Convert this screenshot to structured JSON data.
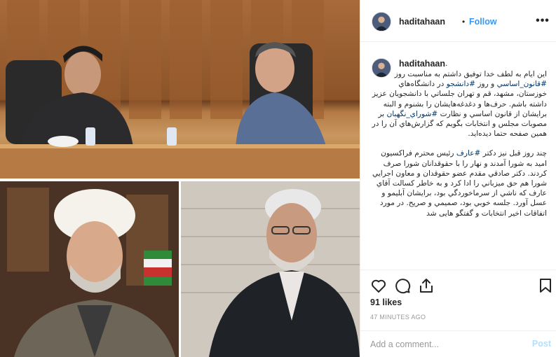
{
  "post": {
    "username": "haditahaan",
    "follow_label": "Follow",
    "more_label": "•••",
    "caption_username": "haditahaan",
    "caption_dot": ".",
    "caption_p1_a": "این ایام به لطف خدا توفیق داشتم به مناسبت روز",
    "caption_p1_tag1": "#قانون_اساسي",
    "caption_p1_b": "و روز",
    "caption_p1_tag2": "#دانشجو",
    "caption_p1_c": "در دانشگاه‌هاي خوزستان، مشهد، قم و تهران جلساتي با دانشجويان عزيز داشته باشم. حرف‌ها و دغدغه‌هايشان را بشنوم و البته برايشان از قانون اساسي و نظارت",
    "caption_p1_tag3": "#شوراي_نگهبان",
    "caption_p1_d": "بر مصوبات مجلس و انتخابات بگويم که گزارش‌هاي آن را در همين صفحه حتما ديده‌ايد.",
    "caption_p2_a": "چند روز قبل نيز دکتر",
    "caption_p2_tag1": "#عارف",
    "caption_p2_b": "رئيس محترم فراکسيون اميد به شورا آمدند و نهار را با حقوقدانان شورا صرف کردند. دکتر صادقي مقدم عضو حقوقدان و معاون اجرايي شورا هم حق ميزباني را ادا کرد و به خاطر کسالت آقاي عارف که ناشي از سرماخوردگي بود، برايشان آبليمو و عسل آورد. جلسه خوبي بود، صميمي و صريح. در مورد اتفاقات اخير انتخابات و گفتگو هایی شد",
    "likes": "91 likes",
    "time": "47 MINUTES AGO",
    "comment_placeholder": "Add a comment...",
    "post_label": "Post"
  },
  "icons": [
    "heart-icon",
    "comment-icon",
    "share-icon",
    "bookmark-icon",
    "more-options-icon"
  ],
  "colors": {
    "link": "#3897f0",
    "hashtag": "#003569",
    "post_disabled": "#b2dffc",
    "border": "#efefef"
  }
}
